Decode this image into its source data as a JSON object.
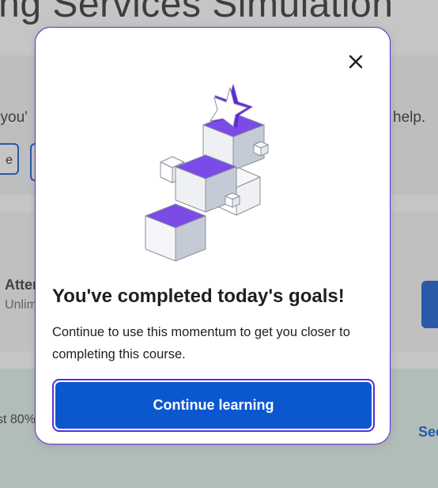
{
  "background": {
    "title": "ing Services Simulation",
    "intro_fragment": "t you'",
    "help_fragment": "help.",
    "pill_left_label": "e",
    "attempts_label": "Atter",
    "attempts_value": "Unlim",
    "pass_text": "st 80%",
    "see_link": "See"
  },
  "modal": {
    "close_icon": "close-icon",
    "illustration_icon": "stacked-cubes-star-illustration",
    "title": "You've completed today's goals!",
    "description": "Continue to use this momentum to get you closer to completing this course.",
    "cta_label": "Continue learning",
    "colors": {
      "accent_purple": "#5b2bd8",
      "primary_blue": "#0b57d0",
      "cube_purple": "#7b4be8",
      "cube_gray": "#c5cbd6"
    }
  }
}
